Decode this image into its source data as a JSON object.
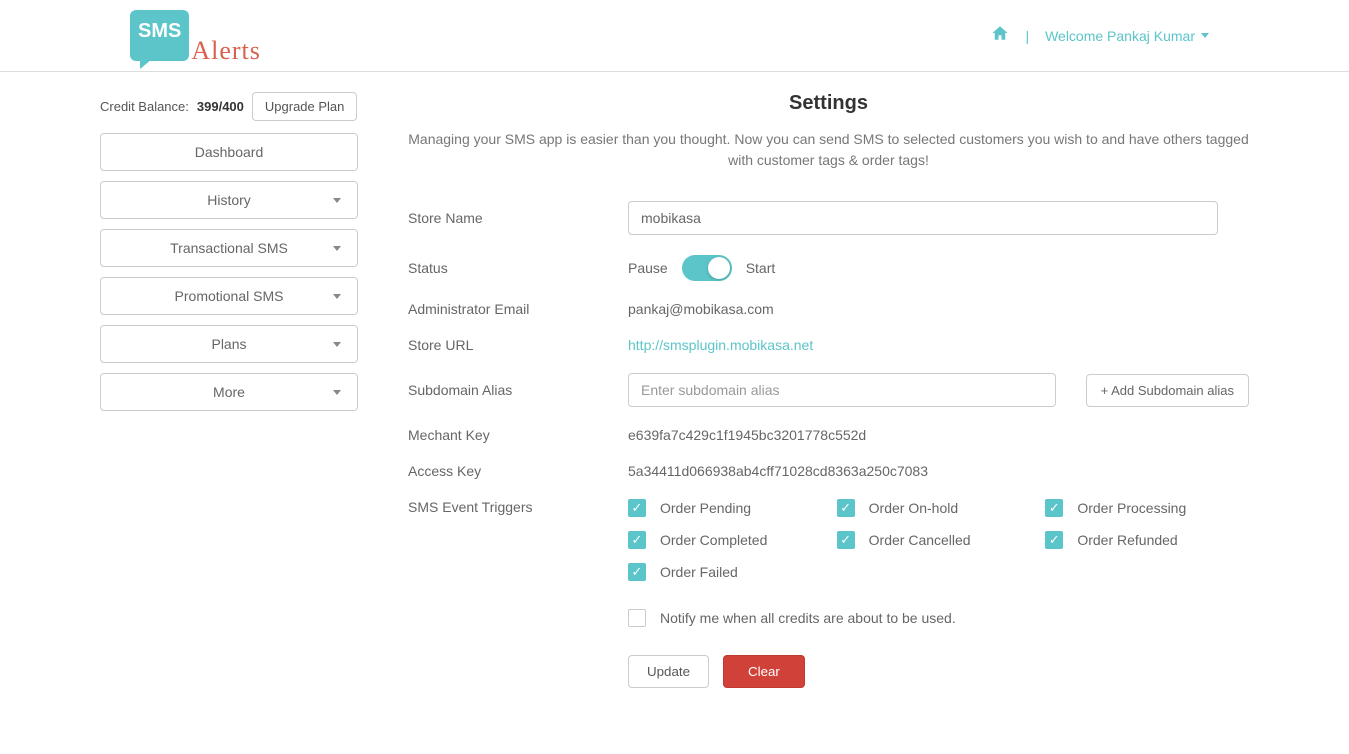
{
  "header": {
    "logo_sms": "SMS",
    "logo_alerts": "Alerts",
    "welcome": "Welcome Pankaj Kumar"
  },
  "sidebar": {
    "credit_label": "Credit Balance:",
    "credit_value": "399/400",
    "upgrade_btn": "Upgrade Plan",
    "items": [
      {
        "label": "Dashboard",
        "dropdown": false
      },
      {
        "label": "History",
        "dropdown": true
      },
      {
        "label": "Transactional SMS",
        "dropdown": true
      },
      {
        "label": "Promotional SMS",
        "dropdown": true
      },
      {
        "label": "Plans",
        "dropdown": true
      },
      {
        "label": "More",
        "dropdown": true
      }
    ]
  },
  "page": {
    "title": "Settings",
    "subtitle": "Managing your SMS app is easier than you thought. Now you can send SMS to selected customers you wish to and have others tagged with customer tags & order tags!"
  },
  "form": {
    "store_name_label": "Store Name",
    "store_name_value": "mobikasa",
    "status_label": "Status",
    "pause": "Pause",
    "start": "Start",
    "admin_email_label": "Administrator Email",
    "admin_email_value": "pankaj@mobikasa.com",
    "store_url_label": "Store URL",
    "store_url_value": "http://smsplugin.mobikasa.net",
    "subdomain_label": "Subdomain Alias",
    "subdomain_placeholder": "Enter subdomain alias",
    "add_subdomain_btn": "+ Add Subdomain alias",
    "merchant_key_label": "Mechant Key",
    "merchant_key_value": "e639fa7c429c1f1945bc3201778c552d",
    "access_key_label": "Access Key",
    "access_key_value": "5a34411d066938ab4cff71028cd8363a250c7083",
    "triggers_label": "SMS Event Triggers",
    "triggers": [
      {
        "label": "Order Pending",
        "checked": true
      },
      {
        "label": "Order On-hold",
        "checked": true
      },
      {
        "label": "Order Processing",
        "checked": true
      },
      {
        "label": "Order Completed",
        "checked": true
      },
      {
        "label": "Order Cancelled",
        "checked": true
      },
      {
        "label": "Order Refunded",
        "checked": true
      },
      {
        "label": "Order Failed",
        "checked": true
      }
    ],
    "notify_label": "Notify me when all credits are about to be used.",
    "notify_checked": false,
    "update_btn": "Update",
    "clear_btn": "Clear"
  }
}
